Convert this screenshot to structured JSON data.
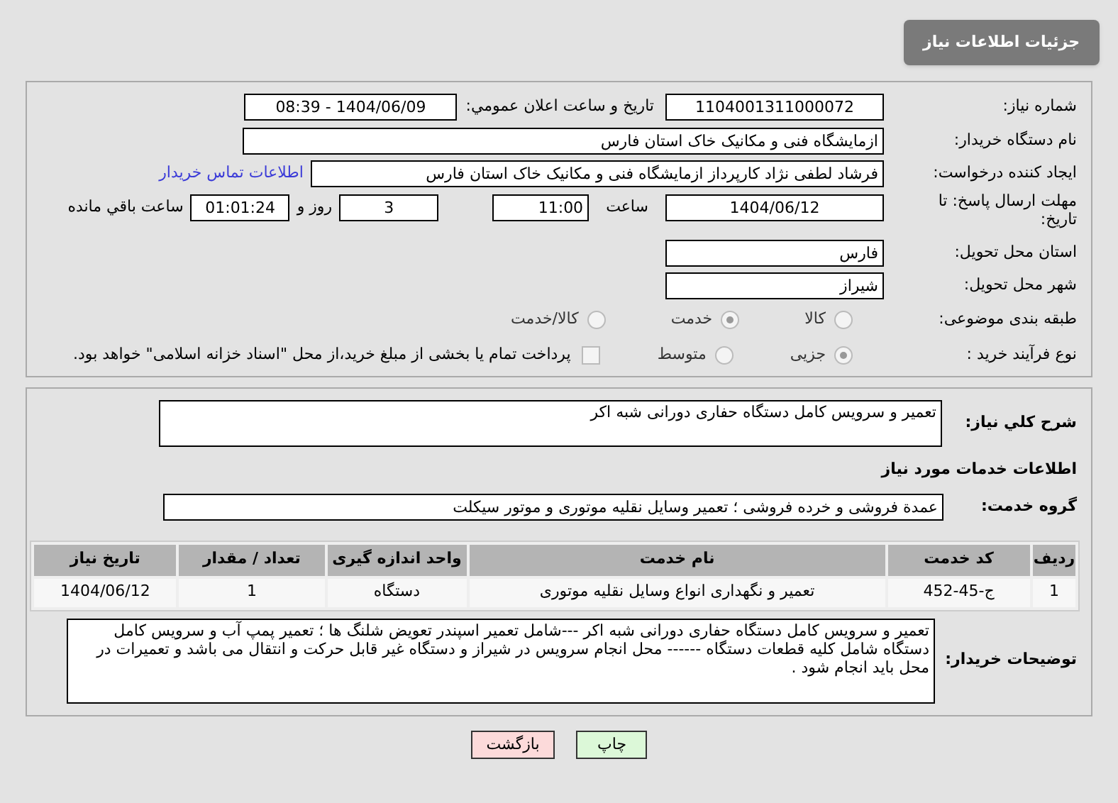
{
  "header": {
    "title": "جزئیات اطلاعات نیاز"
  },
  "need_number": {
    "label": "شماره نیاز:",
    "value": "1104001311000072"
  },
  "announce": {
    "label": "تاریخ و ساعت اعلان عمومي:",
    "value": "1404/06/09 - 08:39"
  },
  "buyer_org": {
    "label": "نام دستگاه خریدار:",
    "value": "ازمایشگاه فنی و مکانیک خاک استان فارس"
  },
  "requester": {
    "label": "ایجاد کننده درخواست:",
    "value": "فرشاد لطفی نژاد کارپرداز ازمایشگاه فنی و مکانیک خاک استان فارس",
    "link": "اطلاعات تماس خریدار"
  },
  "deadline": {
    "label": "مهلت ارسال پاسخ: تا تاریخ:",
    "date": "1404/06/12",
    "time_label": "ساعت",
    "time": "11:00",
    "days": "3",
    "days_label": "روز و",
    "remaining": "01:01:24",
    "remaining_label": "ساعت باقي مانده"
  },
  "province": {
    "label": "استان محل تحویل:",
    "value": "فارس"
  },
  "city": {
    "label": "شهر محل تحویل:",
    "value": "شیراز"
  },
  "category": {
    "label": "طبقه بندی موضوعی:",
    "options": [
      {
        "label": "کالا",
        "selected": false
      },
      {
        "label": "خدمت",
        "selected": true
      },
      {
        "label": "کالا/خدمت",
        "selected": false
      }
    ]
  },
  "process": {
    "label": "نوع فرآیند خرید :",
    "options": [
      {
        "label": "جزیی",
        "selected": true
      },
      {
        "label": "متوسط",
        "selected": false
      }
    ],
    "payment": {
      "checked": false,
      "text": "پرداخت تمام یا بخشی از مبلغ خرید،از محل \"اسناد خزانه اسلامی\" خواهد بود."
    }
  },
  "description": {
    "label": "شرح کلي نياز:",
    "value": "تعمیر و سرویس کامل دستگاه حفاری دورانی شبه اکر"
  },
  "services_heading": "اطلاعات خدمات مورد نیاز",
  "service_group": {
    "label": "گروه خدمت:",
    "value": "عمدة فروشی و خرده فروشی ؛ تعمیر وسایل نقلیه موتوری و موتور سیکلت"
  },
  "table": {
    "columns": [
      "ردیف",
      "کد خدمت",
      "نام خدمت",
      "واحد اندازه گیری",
      "تعداد / مقدار",
      "تاریخ نیاز"
    ],
    "rows": [
      [
        "1",
        "ج-45-452",
        "تعمیر و نگهداری انواع وسایل نقلیه موتوری",
        "دستگاه",
        "1",
        "1404/06/12"
      ]
    ]
  },
  "buyer_notes": {
    "label": "توضیحات خریدار:",
    "value": "تعمیر و سرویس کامل دستگاه حفاری دورانی شبه اکر ---شامل تعمیر اسپندر تعویض شلنگ ها ؛ تعمیر پمپ آب و سرویس کامل دستگاه شامل کلیه قطعات دستگاه ------ محل انجام سرویس در شیراز و دستگاه غیر قابل حرکت و انتقال می باشد و تعمیرات در محل باید انجام شود ."
  },
  "buttons": [
    {
      "label": "چاپ",
      "kind": "print"
    },
    {
      "label": "بازگشت",
      "kind": "back"
    }
  ]
}
